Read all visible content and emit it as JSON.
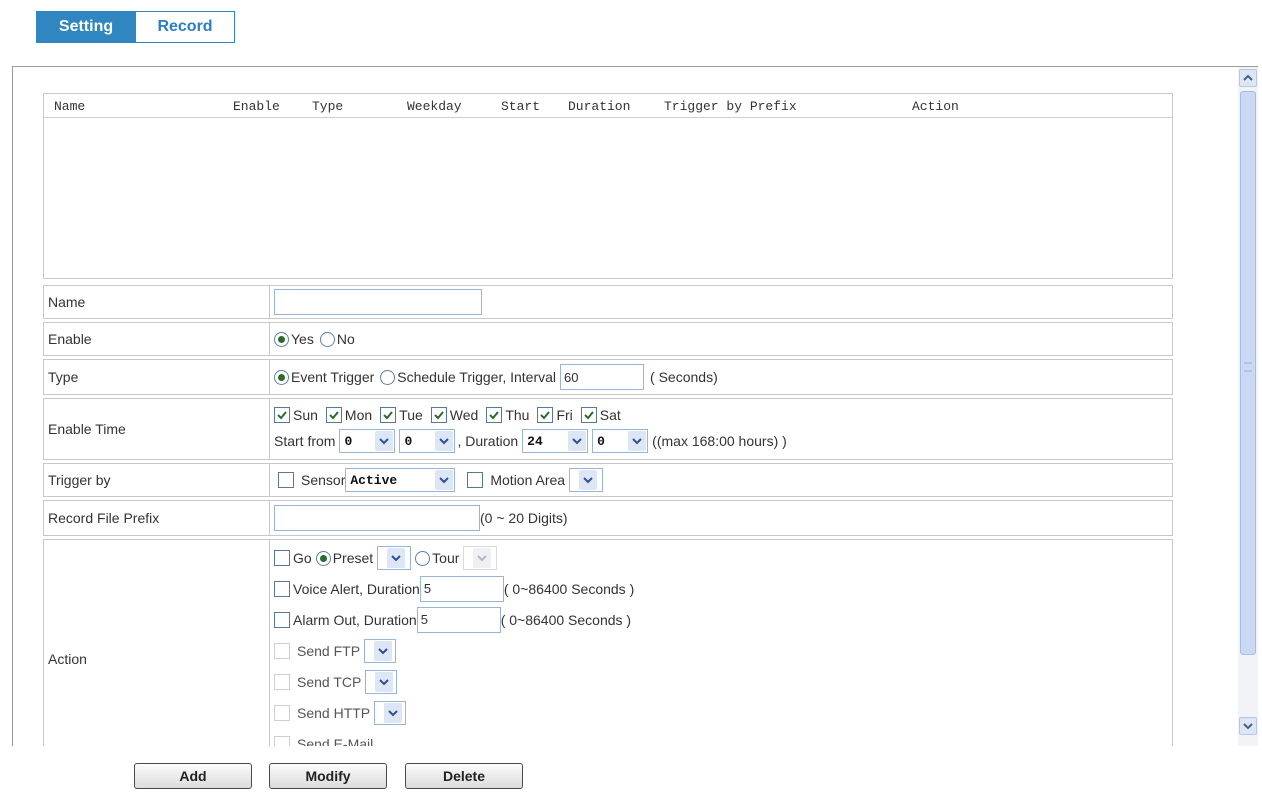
{
  "tabs": [
    {
      "label": "Setting",
      "active": true
    },
    {
      "label": "Record",
      "active": false
    }
  ],
  "list": {
    "columns": [
      "Name",
      "Enable",
      "Type",
      "Weekday",
      "Start",
      "Duration",
      "Trigger by Prefix",
      "Action"
    ]
  },
  "form": {
    "name": {
      "label": "Name",
      "value": ""
    },
    "enable": {
      "label": "Enable",
      "yes": "Yes",
      "no": "No",
      "selected": "Yes"
    },
    "type": {
      "label": "Type",
      "event": "Event Trigger",
      "schedule": "Schedule Trigger, Interval",
      "interval": "60",
      "unit": "( Seconds)",
      "selected": "Event Trigger"
    },
    "enable_time": {
      "label": "Enable Time",
      "days": [
        {
          "label": "Sun",
          "checked": true
        },
        {
          "label": "Mon",
          "checked": true
        },
        {
          "label": "Tue",
          "checked": true
        },
        {
          "label": "Wed",
          "checked": true
        },
        {
          "label": "Thu",
          "checked": true
        },
        {
          "label": "Fri",
          "checked": true
        },
        {
          "label": "Sat",
          "checked": true
        }
      ],
      "start_from": "Start from",
      "start_hour": "0",
      "start_min": "0",
      "duration_label": ", Duration",
      "duration_hour": "24",
      "duration_min": "0",
      "max_note": "((max 168:00 hours) )"
    },
    "trigger_by": {
      "label": "Trigger by",
      "sensor": "Sensor",
      "sensor_value": "Active",
      "motion": "Motion Area",
      "motion_value": ""
    },
    "prefix": {
      "label": "Record File Prefix",
      "value": "",
      "note": "(0 ~ 20 Digits)"
    },
    "action": {
      "label": "Action",
      "go": "Go",
      "preset": "Preset",
      "tour": "Tour",
      "voice": "Voice Alert, Duration",
      "voice_value": "5",
      "voice_note": "( 0~86400 Seconds )",
      "alarm": "Alarm Out, Duration",
      "alarm_value": "5",
      "alarm_note": "( 0~86400 Seconds )",
      "ftp": "Send FTP",
      "tcp": "Send TCP",
      "http": "Send HTTP",
      "email": "Send E-Mail"
    }
  },
  "buttons": {
    "add": "Add",
    "modify": "Modify",
    "delete": "Delete"
  },
  "colors": {
    "accent": "#2f86c0",
    "check": "#2c6a30"
  }
}
